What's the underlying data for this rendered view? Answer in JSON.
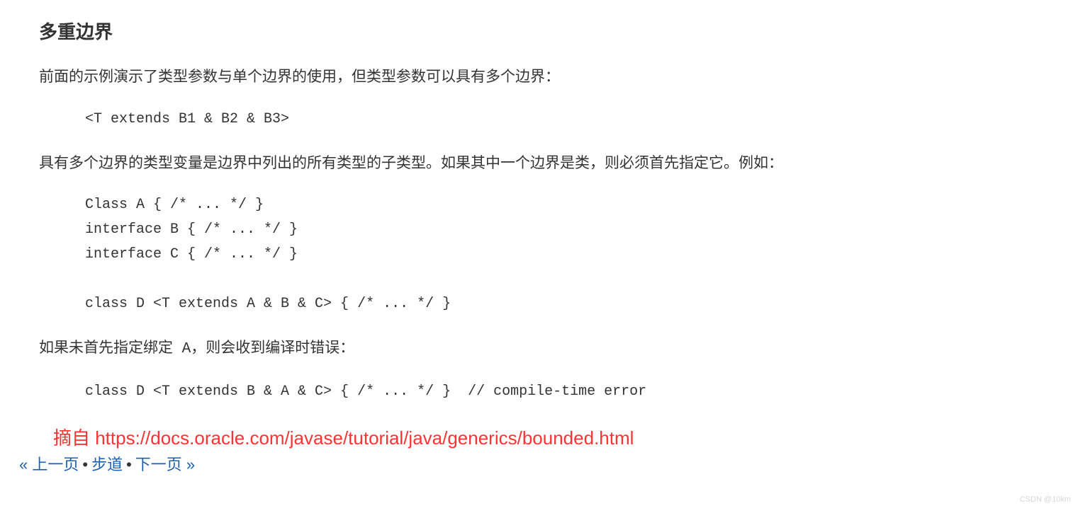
{
  "heading": "多重边界",
  "intro": "前面的示例演示了类型参数与单个边界的使用，但类型参数可以具有多个边界：",
  "code1": "<T extends B1 & B2 & B3>",
  "para2": "具有多个边界的类型变量是边界中列出的所有类型的子类型。如果其中一个边界是类，则必须首先指定它。例如：",
  "code2": "Class A { /* ... */ }\ninterface B { /* ... */ }\ninterface C { /* ... */ }\n\nclass D <T extends A & B & C> { /* ... */ }",
  "para3_prefix": "如果未首先指定绑定",
  "para3_code": " A",
  "para3_suffix": "，则会收到编译时错误：",
  "code3": "class D <T extends B & A & C> { /* ... */ }  // compile-time error",
  "citation": "摘自 https://docs.oracle.com/javase/tutorial/java/generics/bounded.html",
  "nav": {
    "prev_arrow": "« ",
    "prev": "上一页",
    "dot1": "•",
    "trail": "步道",
    "dot2": "•",
    "next": "下一页",
    "next_arrow": " »"
  },
  "watermark": "CSDN @10km"
}
